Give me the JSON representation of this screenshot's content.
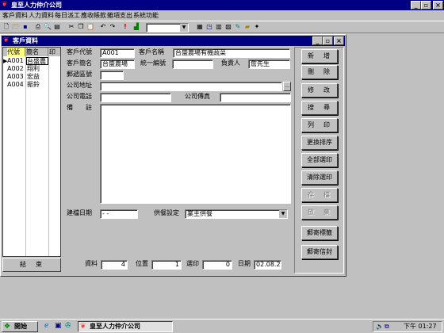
{
  "app": {
    "title": "皇至人力仲介公司"
  },
  "menu": [
    "客戶資料",
    "人力資料",
    "每日派工",
    "應收帳款",
    "雜項支出",
    "系統功能"
  ],
  "toolbar": {
    "combo_value": ""
  },
  "window": {
    "title": "客戶資料"
  },
  "list": {
    "headers": [
      "代號",
      "簡名",
      "印"
    ],
    "rows": [
      {
        "code": "A001",
        "name": "台盛農",
        "current": true
      },
      {
        "code": "A002",
        "name": "翔利"
      },
      {
        "code": "A003",
        "name": "宏益"
      },
      {
        "code": "A004",
        "name": "振鈴"
      }
    ],
    "footer": "結　束"
  },
  "form": {
    "code_label": "客戶代號",
    "code_value": "A001",
    "fullname_label": "客戶名稱",
    "fullname_value": "台盛農場有機蔬菜",
    "shortname_label": "客戶簡名",
    "shortname_value": "台盛農場",
    "taxid_label": "統一編號",
    "taxid_value": "",
    "owner_label": "負責人",
    "owner_value": "詹先生",
    "zip_label": "郵遞區號",
    "zip_value": "",
    "address_label": "公司地址",
    "address_value": "",
    "phone_label": "公司電話",
    "phone_value": "",
    "fax_label": "公司傳真",
    "fax_value": "",
    "notes_label": "備　　註",
    "notes_value": "",
    "date_label": "建檔日期",
    "date_value": " - -",
    "meal_label": "供餐設定",
    "meal_value": "業主供餐"
  },
  "status": {
    "records_label": "資料",
    "records_value": "4",
    "position_label": "位置",
    "position_value": "1",
    "print_sel_label": "選印",
    "print_sel_value": "0",
    "date_label": "日期",
    "date_value": "02.08.23"
  },
  "actions": [
    {
      "label": "新　增",
      "disabled": false
    },
    {
      "label": "刪　除",
      "disabled": false
    },
    {
      "label": "修　改",
      "disabled": false
    },
    {
      "label": "搜　尋",
      "disabled": false
    },
    {
      "label": "列　印",
      "disabled": false
    },
    {
      "label": "更換排序",
      "disabled": false
    },
    {
      "label": "全部選印",
      "disabled": false
    },
    {
      "label": "清除選印",
      "disabled": false
    },
    {
      "label": "存　檔",
      "disabled": true
    },
    {
      "label": "放　棄",
      "disabled": true
    },
    {
      "label": "郵寄標籤",
      "disabled": false
    },
    {
      "label": "郵寄信封",
      "disabled": false
    }
  ],
  "taskbar": {
    "start_label": "開始",
    "task_label": "皇至人力仲介公司",
    "clock": "下午 01:27"
  },
  "colors": {
    "titlebar": "#000080",
    "desktop_bg": "#c0c0c0",
    "select": "#ffff80"
  }
}
